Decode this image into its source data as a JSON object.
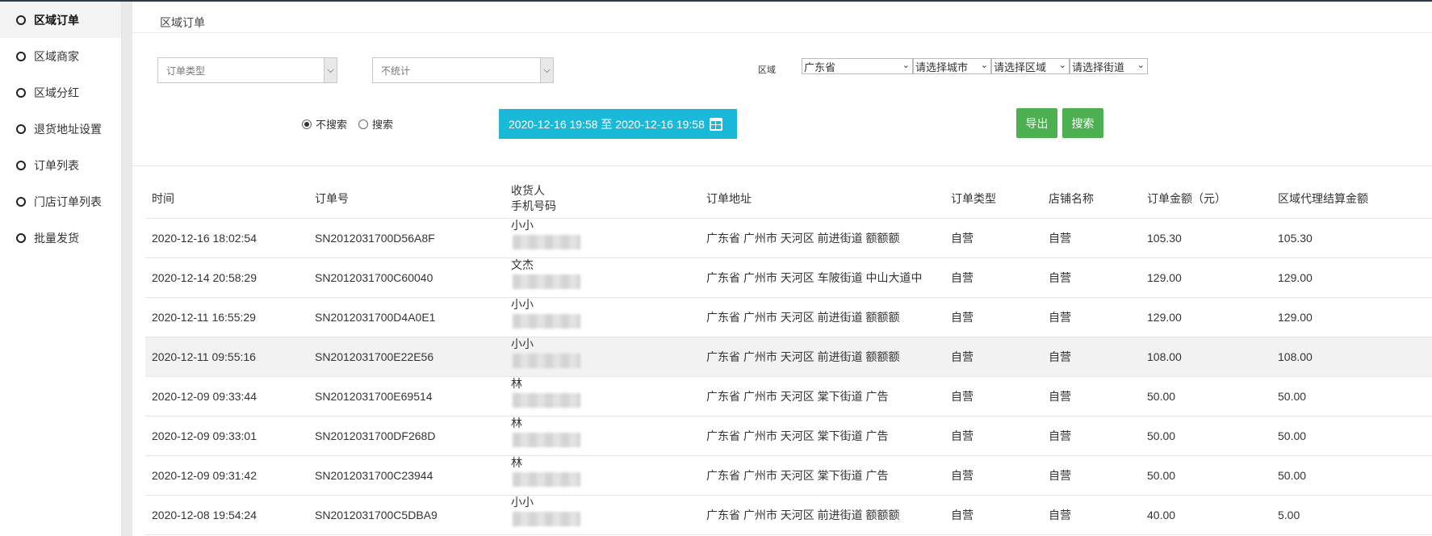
{
  "sidebar": {
    "items": [
      {
        "label": "区域订单",
        "active": true
      },
      {
        "label": "区域商家",
        "active": false
      },
      {
        "label": "区域分红",
        "active": false
      },
      {
        "label": "退货地址设置",
        "active": false
      },
      {
        "label": "订单列表",
        "active": false
      },
      {
        "label": "门店订单列表",
        "active": false
      },
      {
        "label": "批量发货",
        "active": false
      }
    ]
  },
  "header": {
    "breadcrumb": "区域订单"
  },
  "filters": {
    "order_type_placeholder": "订单类型",
    "stat_placeholder": "不统计",
    "region_label": "区域",
    "province": "广东省",
    "city": "请选择城市",
    "district": "请选择区域",
    "street": "请选择街道",
    "radio_no_search": "不搜索",
    "radio_search": "搜索",
    "date_range": "2020-12-16 19:58 至 2020-12-16 19:58",
    "export_label": "导出",
    "search_label": "搜索"
  },
  "colors": {
    "date_button": "#1ab8d9",
    "action_button": "#4caf50"
  },
  "table": {
    "headers": {
      "time": "时间",
      "order_no": "订单号",
      "receiver": "收货人",
      "phone": "手机号码",
      "address": "订单地址",
      "type": "订单类型",
      "shop": "店铺名称",
      "amount": "订单金额（元）",
      "settle": "区域代理结算金额"
    },
    "rows": [
      {
        "time": "2020-12-16 18:02:54",
        "order_no": "SN2012031700D56A8F",
        "receiver": "小小",
        "address": "广东省 广州市 天河区 前进街道 额额额",
        "type": "自营",
        "shop": "自营",
        "amount": "105.30",
        "settle": "105.30"
      },
      {
        "time": "2020-12-14 20:58:29",
        "order_no": "SN2012031700C60040",
        "receiver": "文杰",
        "address": "广东省 广州市 天河区 车陂街道 中山大道中",
        "type": "自营",
        "shop": "自营",
        "amount": "129.00",
        "settle": "129.00"
      },
      {
        "time": "2020-12-11 16:55:29",
        "order_no": "SN2012031700D4A0E1",
        "receiver": "小小",
        "address": "广东省 广州市 天河区 前进街道 额额额",
        "type": "自营",
        "shop": "自营",
        "amount": "129.00",
        "settle": "129.00"
      },
      {
        "time": "2020-12-11 09:55:16",
        "order_no": "SN2012031700E22E56",
        "receiver": "小小",
        "address": "广东省 广州市 天河区 前进街道 额额额",
        "type": "自营",
        "shop": "自营",
        "amount": "108.00",
        "settle": "108.00"
      },
      {
        "time": "2020-12-09 09:33:44",
        "order_no": "SN2012031700E69514",
        "receiver": "林",
        "address": "广东省 广州市 天河区 棠下街道 广告",
        "type": "自营",
        "shop": "自营",
        "amount": "50.00",
        "settle": "50.00"
      },
      {
        "time": "2020-12-09 09:33:01",
        "order_no": "SN2012031700DF268D",
        "receiver": "林",
        "address": "广东省 广州市 天河区 棠下街道 广告",
        "type": "自营",
        "shop": "自营",
        "amount": "50.00",
        "settle": "50.00"
      },
      {
        "time": "2020-12-09 09:31:42",
        "order_no": "SN2012031700C23944",
        "receiver": "林",
        "address": "广东省 广州市 天河区 棠下街道 广告",
        "type": "自营",
        "shop": "自营",
        "amount": "50.00",
        "settle": "50.00"
      },
      {
        "time": "2020-12-08 19:54:24",
        "order_no": "SN2012031700C5DBA9",
        "receiver": "小小",
        "address": "广东省 广州市 天河区 前进街道 额额额",
        "type": "自营",
        "shop": "自营",
        "amount": "40.00",
        "settle": "5.00"
      }
    ]
  }
}
